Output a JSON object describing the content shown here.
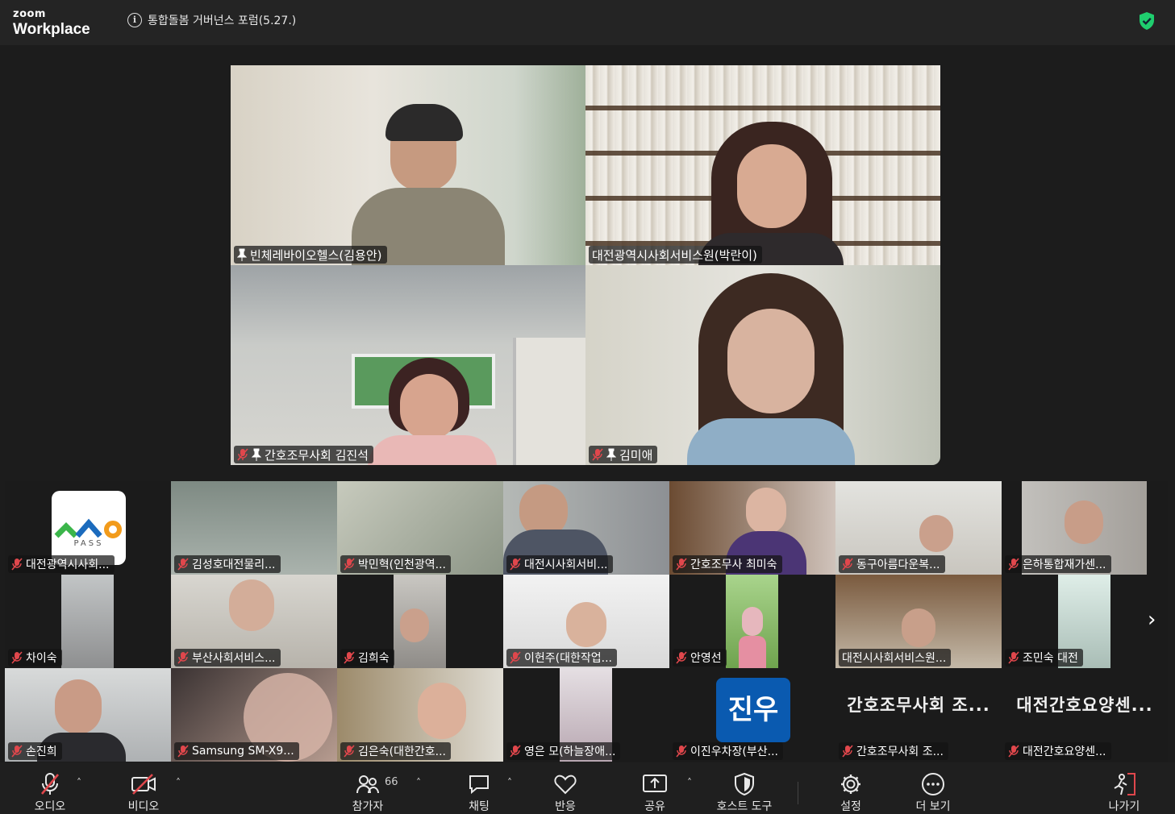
{
  "app": {
    "logo_small": "zoom",
    "logo_big": "Workplace"
  },
  "meeting": {
    "title": "통합돌봄 거버넌스 포럼(5.27.)"
  },
  "featured": [
    {
      "name": "빈체레바이오헬스(김용안)",
      "pinned": true,
      "muted": false,
      "speaker": false
    },
    {
      "name": "대전광역시사회서비스원(박란이)",
      "pinned": false,
      "muted": false,
      "speaker": true
    },
    {
      "name": "간호조무사회 김진석",
      "pinned": true,
      "muted": true,
      "speaker": false
    },
    {
      "name": "김미애",
      "pinned": true,
      "muted": true,
      "speaker": false
    }
  ],
  "gallery": [
    {
      "name": "대전광역시사회..."
    },
    {
      "name": "김성호대전물리..."
    },
    {
      "name": "박민혁(인천광역..."
    },
    {
      "name": "대전시사회서비..."
    },
    {
      "name": "간호조무사 최미숙"
    },
    {
      "name": "동구아름다운복..."
    },
    {
      "name": "은하통합재가센..."
    },
    {
      "name": "차이숙"
    },
    {
      "name": "부산사회서비스..."
    },
    {
      "name": "김희숙"
    },
    {
      "name": "이헌주(대한작업..."
    },
    {
      "name": "안영선"
    },
    {
      "name": "대전시사회서비스원..."
    },
    {
      "name": "조민숙 대전"
    },
    {
      "name": "손진희"
    },
    {
      "name": "Samsung SM-X9..."
    },
    {
      "name": "김은숙(대한간호..."
    },
    {
      "name": "영은 모(하늘장애..."
    },
    {
      "name": "이진우차장(부산..."
    },
    {
      "name": "간호조무사회 조..."
    },
    {
      "name": "대전간호요양센..."
    }
  ],
  "avatar_tiles": {
    "pass_logo_text": "PASS",
    "jinwoo_avatar": "진우",
    "big_name_1": "간호조무사회 조...",
    "big_name_2": "대전간호요양센..."
  },
  "toolbar": {
    "audio": "오디오",
    "video": "비디오",
    "participants": "참가자",
    "participants_count": "66",
    "chat": "채팅",
    "reactions": "반응",
    "share": "공유",
    "host_tools": "호스트 도구",
    "settings": "설정",
    "more": "더 보기",
    "leave": "나가기"
  },
  "colors": {
    "active_speaker": "#22c77a",
    "muted_red": "#e0474c",
    "shield_green": "#1fce6e",
    "leave_red": "#e0474c"
  }
}
